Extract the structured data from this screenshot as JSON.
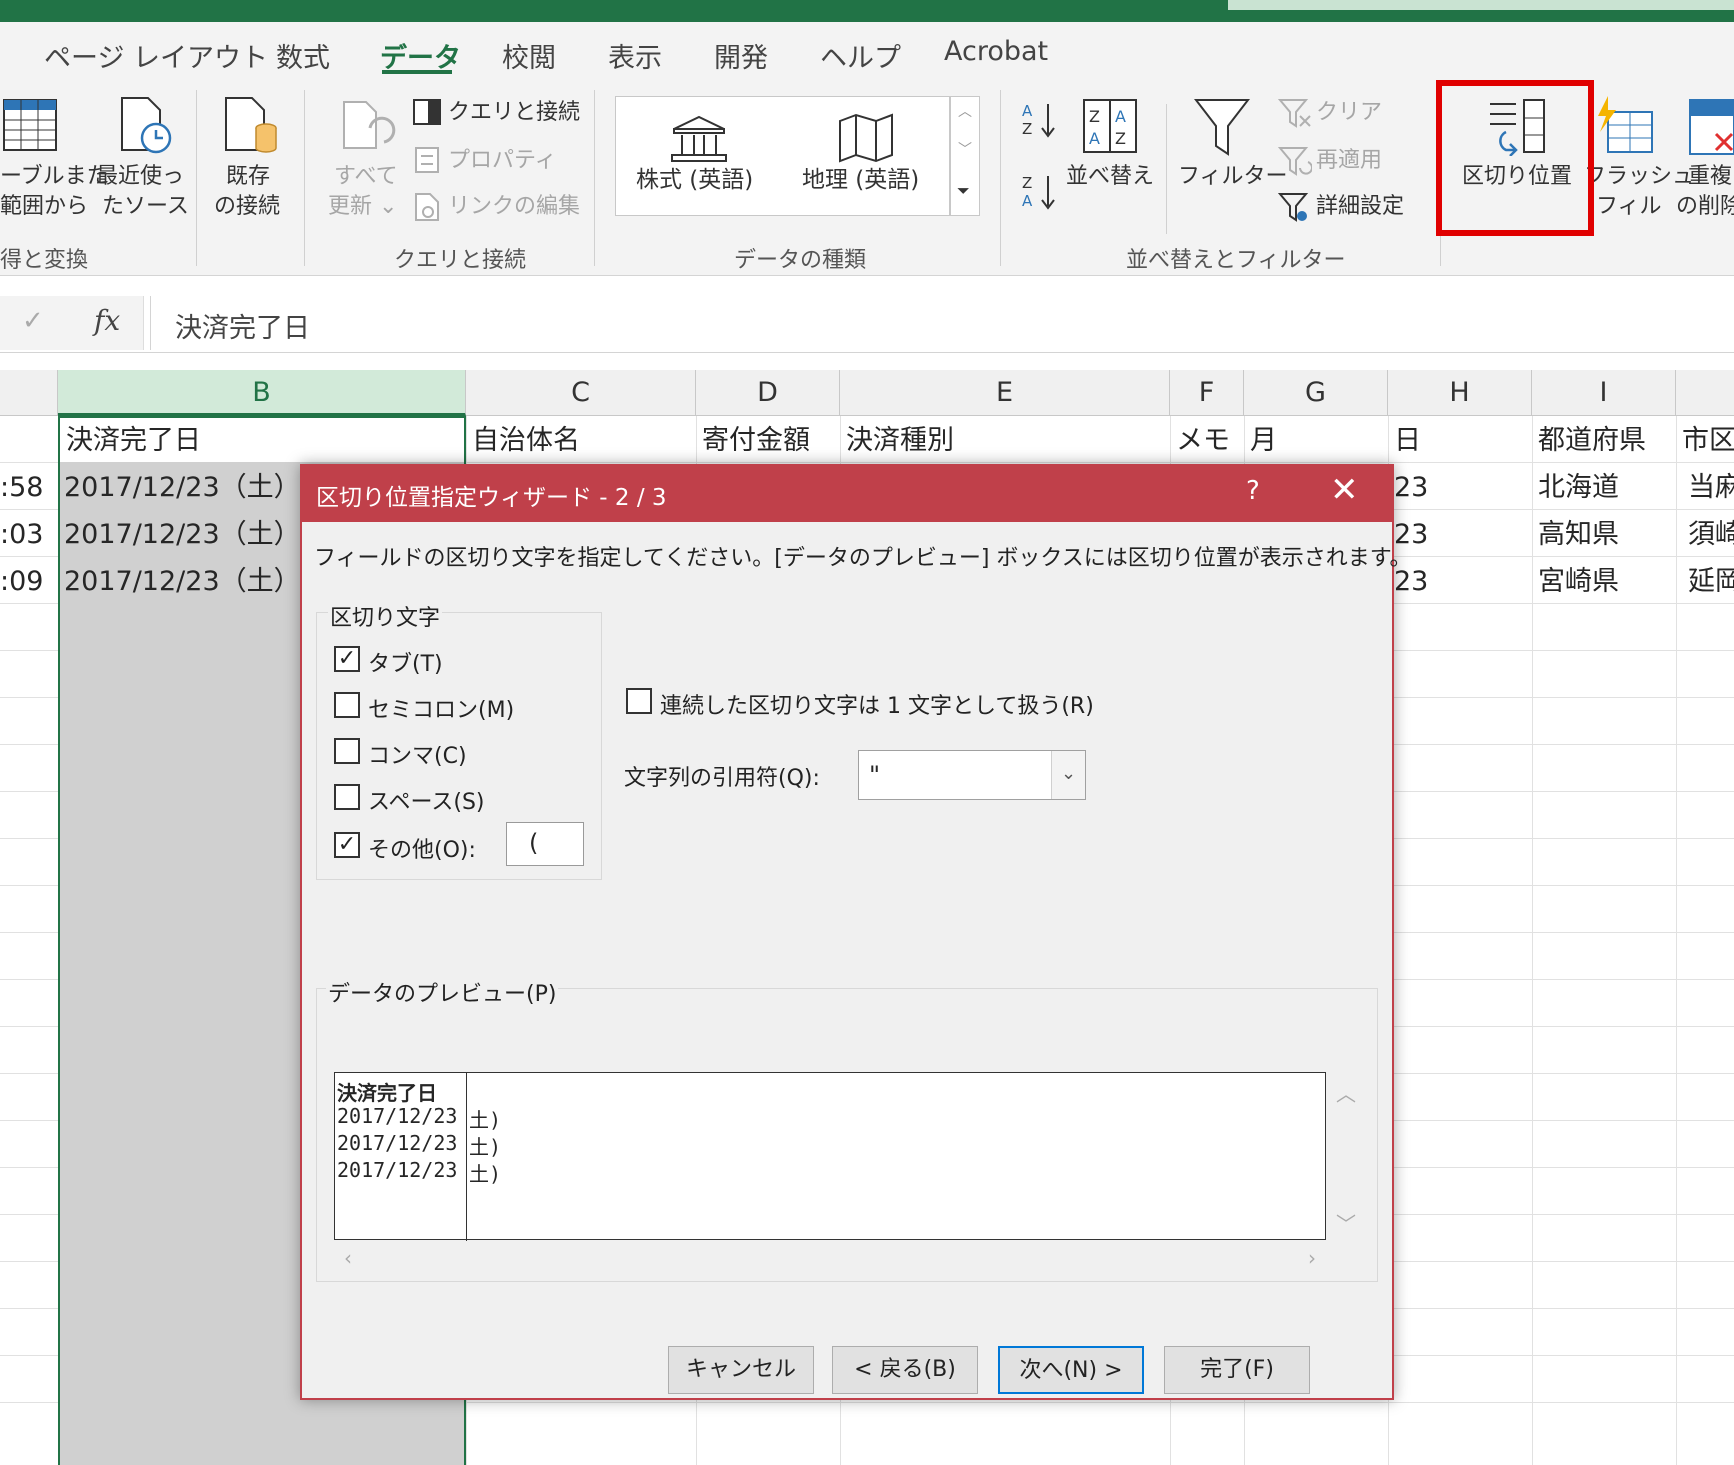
{
  "tabs": [
    "ページ レイアウト",
    "数式",
    "データ",
    "校閲",
    "表示",
    "開発",
    "ヘルプ",
    "Acrobat"
  ],
  "ribbon": {
    "getdata": {
      "line1a": "ーブルまた",
      "line1b": "範囲から",
      "line2a": "最近使っ",
      "line2b": "たソース",
      "line3a": "既存",
      "line3b": "の接続",
      "group": "得と変換"
    },
    "queries": {
      "refresh_a": "すべて",
      "refresh_b": "更新 ⌄",
      "queries_conn": "クエリと接続",
      "properties": "プロパティ",
      "edit_links": "リンクの編集",
      "group": "クエリと接続"
    },
    "datatypes": {
      "stocks": "株式 (英語)",
      "geography": "地理 (英語)",
      "group": "データの種類"
    },
    "sort": {
      "sort": "並べ替え",
      "filter": "フィルター",
      "clear": "クリア",
      "reapply": "再適用",
      "advanced": "詳細設定",
      "group": "並べ替えとフィルター"
    },
    "tools": {
      "text_to_columns": "区切り位置",
      "flash_a": "フラッシュ",
      "flash_b": "フィル",
      "dup_a": "重複",
      "dup_b": "の削除"
    }
  },
  "formula": {
    "fx": "fx",
    "check": "✓",
    "value": "決済完了日"
  },
  "columns": [
    "B",
    "C",
    "D",
    "E",
    "F",
    "G",
    "H",
    "I"
  ],
  "sheet": {
    "row1": {
      "B": "決済完了日",
      "C": "自治体名",
      "D": "寄付金額",
      "E": "決済種別",
      "F": "メモ",
      "G": "月",
      "H": "日",
      "I": "都道府県",
      "J": "市区"
    },
    "rows": [
      {
        "A": ":58",
        "B": "2017/12/23（土）",
        "H": "23",
        "I": "北海道",
        "J": "当麻"
      },
      {
        "A": ":03",
        "B": "2017/12/23（土）",
        "H": "23",
        "I": "高知県",
        "J": "須崎"
      },
      {
        "A": ":09",
        "B": "2017/12/23（土）",
        "H": "23",
        "I": "宮崎県",
        "J": "延岡"
      }
    ]
  },
  "dialog": {
    "title": "区切り位置指定ウィザード - 2 / 3",
    "help": "?",
    "close": "✕",
    "instruction": "フィールドの区切り文字を指定してください。[データのプレビュー] ボックスには区切り位置が表示されます。",
    "delim_group": "区切り文字",
    "options": [
      {
        "label": "タブ(T)",
        "checked": true
      },
      {
        "label": "セミコロン(M)",
        "checked": false
      },
      {
        "label": "コンマ(C)",
        "checked": false
      },
      {
        "label": "スペース(S)",
        "checked": false
      },
      {
        "label": "その他(O):",
        "checked": true
      }
    ],
    "other_value": "(",
    "consecutive": "連続した区切り文字は 1 文字として扱う(R)",
    "qualifier_label": "文字列の引用符(Q):",
    "qualifier_value": "\"",
    "preview_label": "データのプレビュー(P)",
    "preview_col1": [
      "決済完了日",
      "2017/12/23",
      "2017/12/23",
      "2017/12/23"
    ],
    "preview_col2": [
      "",
      "土)",
      "土)",
      "土)"
    ],
    "buttons": {
      "cancel": "キャンセル",
      "back": "< 戻る(B)",
      "next": "次へ(N) >",
      "finish": "完了(F)"
    }
  },
  "colors": {
    "excel_green": "#217346",
    "dialog_title": "#c0404a",
    "highlight": "#e00000"
  }
}
